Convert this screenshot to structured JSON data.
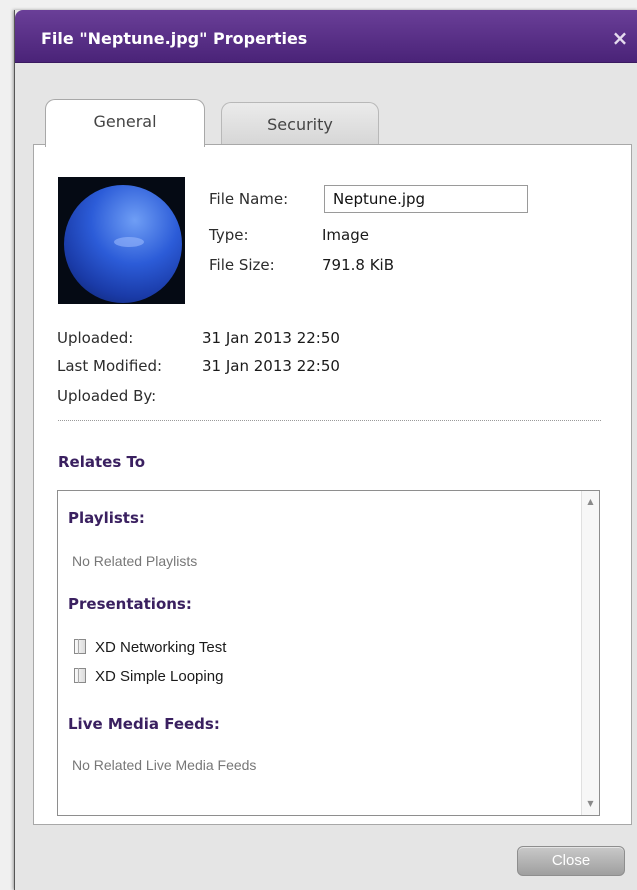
{
  "dialog": {
    "title": "File \"Neptune.jpg\" Properties",
    "close_icon": "×"
  },
  "tabs": [
    {
      "label": "General",
      "active": true
    },
    {
      "label": "Security",
      "active": false
    }
  ],
  "file_info": {
    "thumbnail_icon": "neptune-image",
    "name_label": "File Name:",
    "name_value": "Neptune.jpg",
    "type_label": "Type:",
    "type_value": "Image",
    "size_label": "File Size:",
    "size_value": "791.8 KiB"
  },
  "meta": {
    "uploaded_label": "Uploaded:",
    "uploaded_value": "31 Jan 2013 22:50",
    "modified_label": "Last Modified:",
    "modified_value": "31 Jan 2013 22:50",
    "uploaded_by_label": "Uploaded By:",
    "uploaded_by_value": ""
  },
  "relates": {
    "heading": "Relates To",
    "playlists_heading": "Playlists:",
    "playlists_empty": "No Related Playlists",
    "presentations_heading": "Presentations:",
    "presentations": [
      "XD Networking Test",
      "XD Simple Looping"
    ],
    "live_feeds_heading": "Live Media Feeds:",
    "live_feeds_empty": "No Related Live Media Feeds"
  },
  "footer": {
    "close_label": "Close"
  },
  "colors": {
    "titlebar": "#5a2f88",
    "heading": "#3a2060"
  }
}
